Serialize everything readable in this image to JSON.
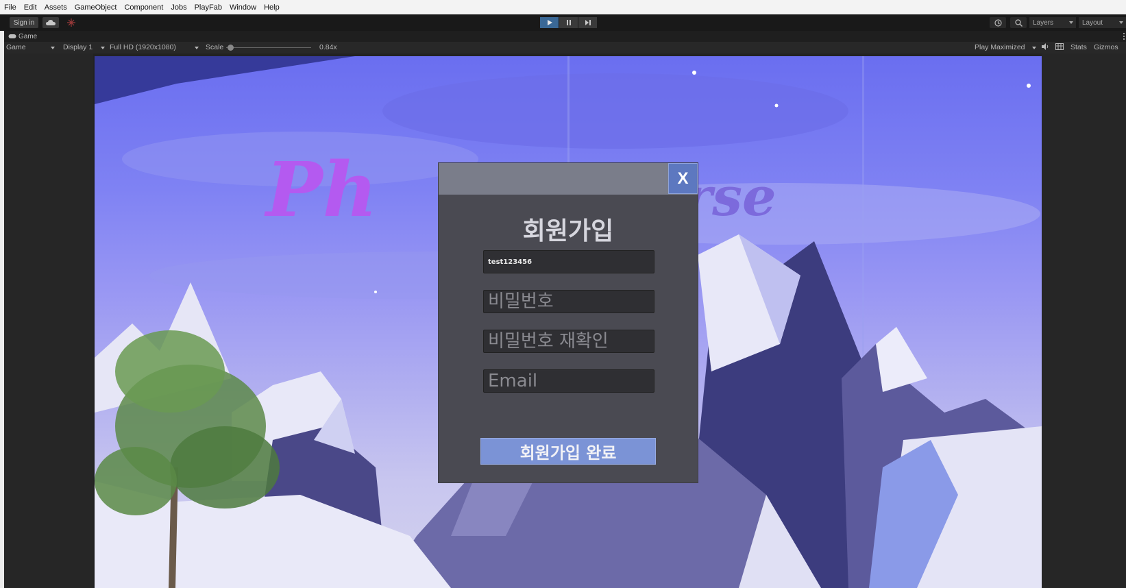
{
  "menubar": {
    "items": [
      "File",
      "Edit",
      "Assets",
      "GameObject",
      "Component",
      "Jobs",
      "PlayFab",
      "Window",
      "Help"
    ]
  },
  "toolbar": {
    "sign_in": "Sign in",
    "layers": "Layers",
    "layout": "Layout"
  },
  "game_panel": {
    "tab_label": "Game",
    "view_dropdown": "Game",
    "display": "Display 1",
    "resolution": "Full HD (1920x1080)",
    "scale_label": "Scale",
    "scale_value": "0.84x",
    "play_mode": "Play Maximized",
    "stats": "Stats",
    "gizmos": "Gizmos"
  },
  "game": {
    "logo_left": "Ph",
    "logo_right": "rse"
  },
  "signup": {
    "title": "회원가입",
    "close_label": "X",
    "id_value": "test123456",
    "password_placeholder": "비밀번호",
    "password_confirm_placeholder": "비밀번호 재확인",
    "email_placeholder": "Email",
    "submit_label": "회원가입 완료"
  },
  "colors": {
    "play_active": "#3a6896",
    "modal_bg": "#4a4a52",
    "close_button": "#5d78c0",
    "submit_button": "#7b93d6",
    "logo": "#b45af0"
  }
}
